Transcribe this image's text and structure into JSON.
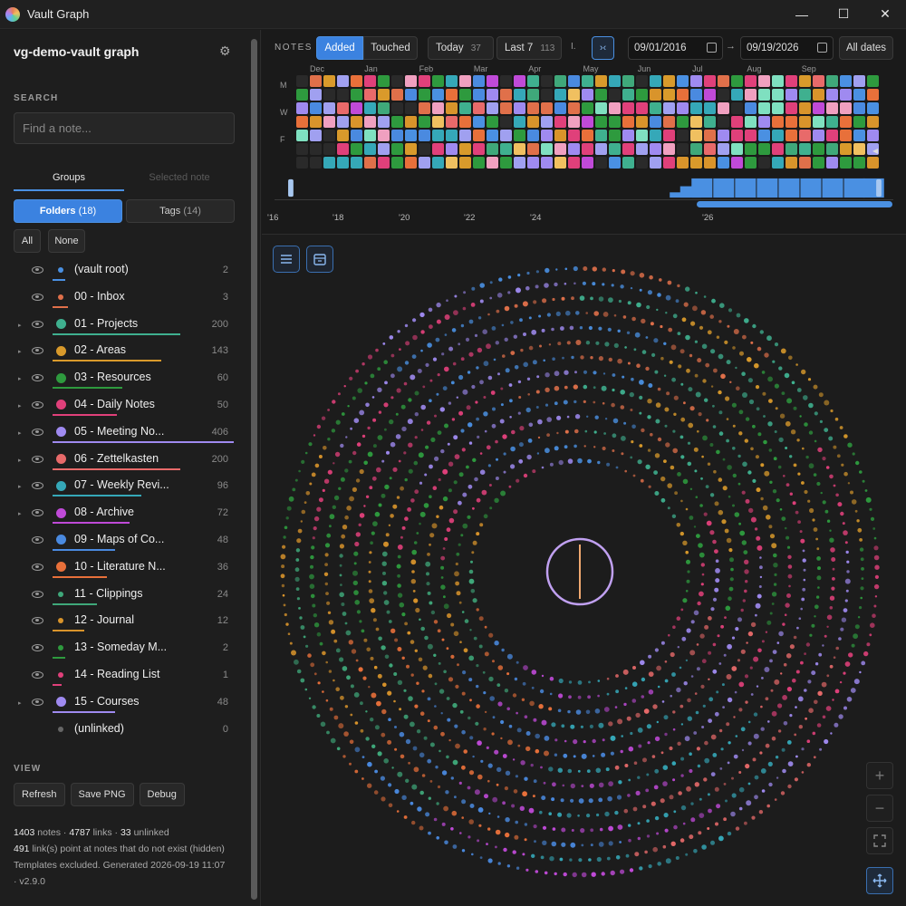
{
  "window": {
    "title": "Vault Graph",
    "minimize": "—",
    "maximize": "☐",
    "close": "✕"
  },
  "sidebar": {
    "vault_title": "vg-demo-vault graph",
    "search_label": "SEARCH",
    "search_placeholder": "Find a note...",
    "tabs": [
      "Groups",
      "Selected note"
    ],
    "seg_folders": "Folders",
    "seg_folders_count": "(18)",
    "seg_tags": "Tags",
    "seg_tags_count": "(14)",
    "all_label": "All",
    "none_label": "None",
    "folders": [
      {
        "name": "(vault root)",
        "count": "2",
        "color": "#4a90e2",
        "expandable": false
      },
      {
        "name": "00 - Inbox",
        "count": "3",
        "color": "#e0704a",
        "expandable": false
      },
      {
        "name": "01 - Projects",
        "count": "200",
        "color": "#3fb08f",
        "expandable": true
      },
      {
        "name": "02 - Areas",
        "count": "143",
        "color": "#d99a2b",
        "expandable": true
      },
      {
        "name": "03 - Resources",
        "count": "60",
        "color": "#2e9a3e",
        "expandable": true
      },
      {
        "name": "04 - Daily Notes",
        "count": "50",
        "color": "#e0407a",
        "expandable": true
      },
      {
        "name": "05 - Meeting No...",
        "count": "406",
        "color": "#9f8af0",
        "expandable": true
      },
      {
        "name": "06 - Zettelkasten",
        "count": "200",
        "color": "#e86a6a",
        "expandable": true
      },
      {
        "name": "07 - Weekly Revi...",
        "count": "96",
        "color": "#35a8b8",
        "expandable": true
      },
      {
        "name": "08 - Archive",
        "count": "72",
        "color": "#c04ad8",
        "expandable": true
      },
      {
        "name": "09 - Maps of Co...",
        "count": "48",
        "color": "#4a8ae0",
        "expandable": false
      },
      {
        "name": "10 - Literature N...",
        "count": "36",
        "color": "#e8703a",
        "expandable": false
      },
      {
        "name": "11 - Clippings",
        "count": "24",
        "color": "#3fa87a",
        "expandable": false
      },
      {
        "name": "12 - Journal",
        "count": "12",
        "color": "#d9942b",
        "expandable": false
      },
      {
        "name": "13 - Someday M...",
        "count": "2",
        "color": "#2e9a3e",
        "expandable": false
      },
      {
        "name": "14 - Reading List",
        "count": "1",
        "color": "#e0407a",
        "expandable": false
      },
      {
        "name": "15 - Courses",
        "count": "48",
        "color": "#9f8af0",
        "expandable": true
      },
      {
        "name": "(unlinked)",
        "count": "0",
        "color": "#666666",
        "expandable": false
      }
    ],
    "view_label": "VIEW",
    "view_buttons": [
      "Refresh",
      "Save PNG",
      "Debug"
    ],
    "stats": {
      "notes": "1403",
      "notes_label": "notes",
      "links": "4787",
      "links_label": "links",
      "unlinked": "33",
      "unlinked_label": "unlinked",
      "broken": "491",
      "broken_label": "link(s) point at notes that do not exist (hidden)",
      "footer": "Templates excluded. Generated 2026-09-19 11:07",
      "version": "· v2.9.0"
    }
  },
  "notes_bar": {
    "label": "NOTES",
    "mode_added": "Added",
    "mode_touched": "Touched",
    "today_label": "Today",
    "today_count": "37",
    "last7_label": "Last 7",
    "last7_count": "113",
    "sep": "I.",
    "date_from": "09/01/2016",
    "arrow": "→",
    "date_to": "09/19/2026",
    "all_dates": "All dates",
    "months": [
      "Dec",
      "Jan",
      "Feb",
      "Mar",
      "Apr",
      "May",
      "Jun",
      "Jul",
      "Aug",
      "Sep"
    ],
    "weekdays": [
      "M",
      "W",
      "F"
    ],
    "years": [
      "'16",
      "'18",
      "'20",
      "'22",
      "'24",
      "'26"
    ]
  },
  "colors": {
    "accent": "#3b82e0"
  }
}
